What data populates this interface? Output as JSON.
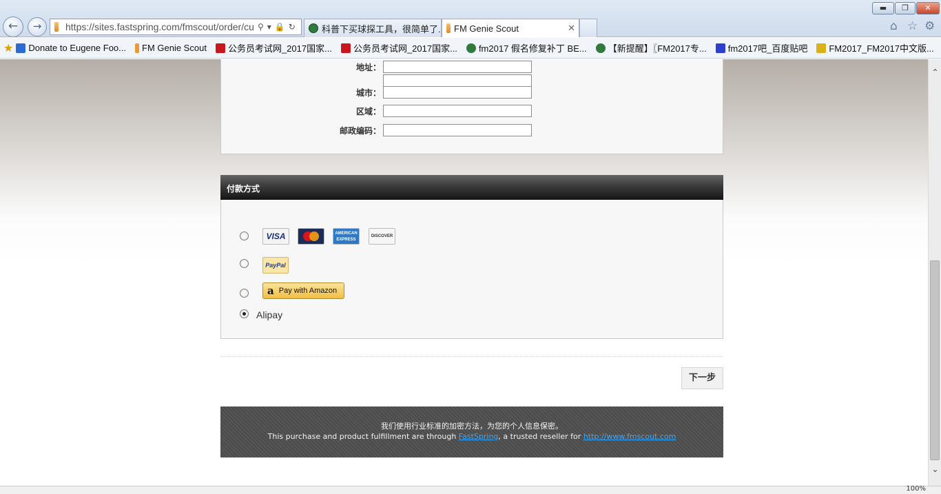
{
  "browser": {
    "url": "https://sites.fastspring.com/fmscout/order/cus",
    "tabs": [
      {
        "title": "科普下买球探工具，很简单了..."
      },
      {
        "title": "FM Genie Scout"
      }
    ],
    "window_buttons": {
      "minimize": "▬",
      "maximize": "❐",
      "close": "✕"
    },
    "favorites": [
      {
        "label": "Donate to Eugene Foo...",
        "icon": "ie-page-icon"
      },
      {
        "label": "FM Genie Scout",
        "icon": "bookmark-page-icon"
      },
      {
        "label": "公务员考试网_2017国家...",
        "icon": "red-grid-icon"
      },
      {
        "label": "公务员考试网_2017国家...",
        "icon": "red-grid-icon"
      },
      {
        "label": "fm2017 假名修复补丁 BE...",
        "icon": "green-site-icon"
      },
      {
        "label": "【新提醒】〖FM2017专...",
        "icon": "green-site-icon"
      },
      {
        "label": "fm2017吧_百度贴吧",
        "icon": "baidu-paw-icon"
      },
      {
        "label": "FM2017_FM2017中文版...",
        "icon": "we-logo-icon"
      }
    ],
    "zoom": "100%"
  },
  "address_form": {
    "fields": [
      {
        "label": "地址：",
        "value": ""
      },
      {
        "label": "",
        "value": ""
      },
      {
        "label": "城市：",
        "value": ""
      },
      {
        "label": "区域：",
        "value": ""
      },
      {
        "label": "邮政编码：",
        "value": ""
      }
    ]
  },
  "payment": {
    "title": "付款方式",
    "options": [
      {
        "id": "cards",
        "selected": false,
        "cards": [
          "VISA",
          "MasterCard",
          "AMERICAN EXPRESS",
          "DISCOVER"
        ]
      },
      {
        "id": "paypal",
        "selected": false,
        "label": "PayPal"
      },
      {
        "id": "amazon",
        "selected": false,
        "label": "Pay with Amazon",
        "logo": "a"
      },
      {
        "id": "alipay",
        "selected": true,
        "label": "Alipay"
      }
    ]
  },
  "next_button": "下一步",
  "footer": {
    "line1": "我们使用行业标准的加密方法，为您的个人信息保密。",
    "line2_pre": "This purchase and product fulfillment are through ",
    "link1": "FastSpring",
    "line2_mid": ", a trusted reseller for ",
    "link2": "http://www.fmscout.com"
  },
  "colors": {
    "link": "#36a9ff",
    "header_dark": "#2a2a2a",
    "footer_bg": "#505050"
  }
}
